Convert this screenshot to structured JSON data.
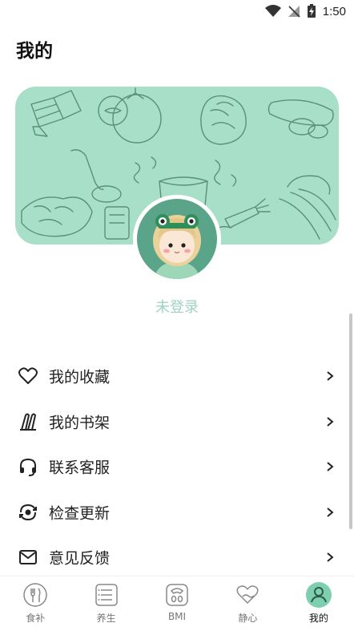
{
  "status_bar": {
    "time": "1:50",
    "icons": [
      "wifi-icon",
      "no-signal-icon",
      "battery-charging-icon"
    ]
  },
  "header": {
    "title": "我的"
  },
  "profile": {
    "login_status": "未登录"
  },
  "menu": {
    "items": [
      {
        "label": "我的收藏",
        "icon": "heart-icon"
      },
      {
        "label": "我的书架",
        "icon": "bookshelf-icon"
      },
      {
        "label": "联系客服",
        "icon": "headset-icon"
      },
      {
        "label": "检查更新",
        "icon": "refresh-eye-icon"
      },
      {
        "label": "意见反馈",
        "icon": "mail-icon"
      }
    ]
  },
  "tabs": [
    {
      "label": "食补",
      "icon": "food-icon"
    },
    {
      "label": "养生",
      "icon": "list-icon"
    },
    {
      "label": "BMI",
      "icon": "scale-icon"
    },
    {
      "label": "静心",
      "icon": "heart-hand-icon"
    },
    {
      "label": "我的",
      "icon": "user-icon"
    }
  ],
  "colors": {
    "accent": "#7ecfb0",
    "banner_bg": "#a8dfc8",
    "muted_text": "#9fd3c0"
  }
}
